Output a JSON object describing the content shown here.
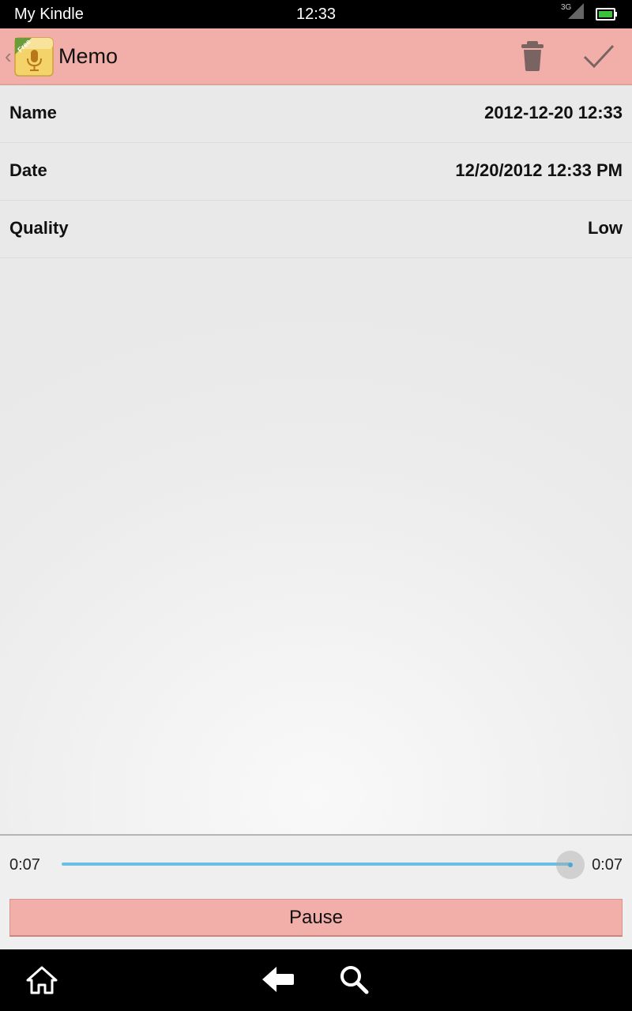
{
  "status_bar": {
    "carrier": "My Kindle",
    "time": "12:33",
    "network": "3G",
    "icons": [
      "signal-icon",
      "battery-icon"
    ]
  },
  "action_bar": {
    "title": "Memo",
    "app_icon_badge": "Free",
    "icons": [
      "back-chevron-icon",
      "microphone-app-icon",
      "trash-icon",
      "check-icon"
    ]
  },
  "fields": [
    {
      "label": "Name",
      "value": "2012-12-20 12:33"
    },
    {
      "label": "Date",
      "value": "12/20/2012 12:33 PM"
    },
    {
      "label": "Quality",
      "value": "Low"
    }
  ],
  "player": {
    "elapsed": "0:07",
    "duration": "0:07",
    "progress": 1.0,
    "button_label": "Pause"
  },
  "nav_bar": {
    "icons": [
      "home-icon",
      "back-arrow-icon",
      "search-icon"
    ]
  },
  "colors": {
    "accent": "#f2aea8",
    "progress": "#6bbfe3"
  }
}
